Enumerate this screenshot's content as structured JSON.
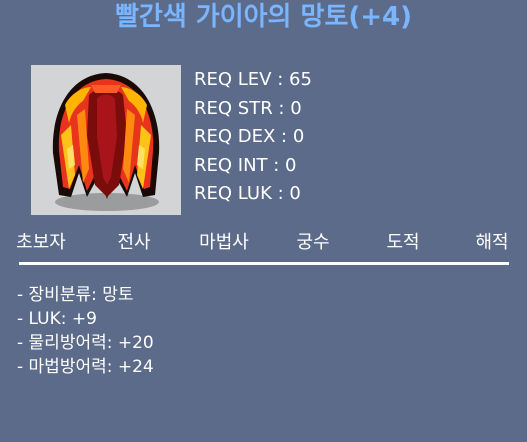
{
  "item": {
    "name": "빨간색 가이아의 망토(+4)",
    "icon": "red-cape-icon"
  },
  "requirements": [
    "REQ LEV : 65",
    "REQ STR : 0",
    "REQ DEX : 0",
    "REQ INT : 0",
    "REQ LUK : 0"
  ],
  "jobs": [
    "초보자",
    "전사",
    "마법사",
    "궁수",
    "도적",
    "해적"
  ],
  "stats": [
    "- 장비분류: 망토",
    "- LUK: +9",
    "- 물리방어력: +20",
    "- 마법방어력: +24"
  ],
  "colors": {
    "background": "#5c6b8a",
    "title": "#7ab5ff",
    "text": "#ffffff",
    "icon_bg": "#d2d4d6"
  }
}
